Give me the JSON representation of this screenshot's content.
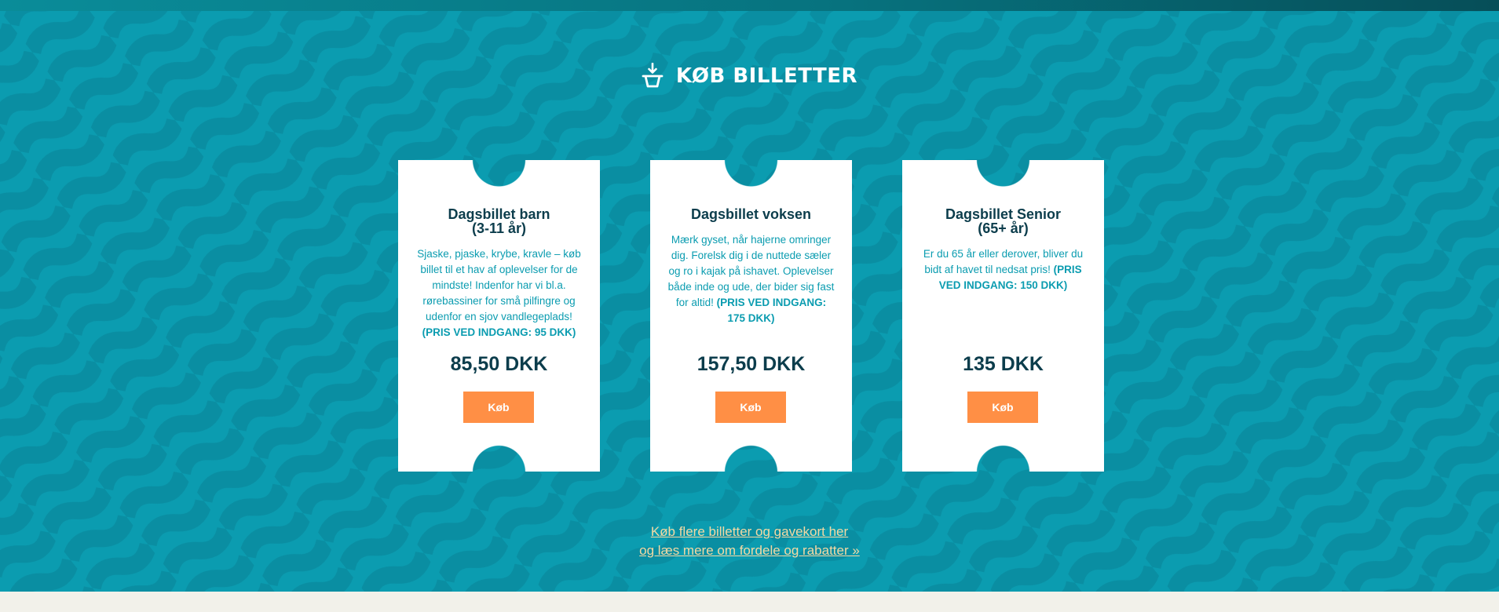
{
  "section": {
    "title": "KØB BILLETTER",
    "icon": "basket-download-icon"
  },
  "tickets": [
    {
      "title_line1": "Dagsbillet barn",
      "title_line2": "(3-11 år)",
      "description": "Sjaske, pjaske, krybe, kravle – køb billet til et hav af oplevelser for de mindste! Indenfor har vi bl.a. rørebassiner for små pilfingre og udenfor en sjov vandlegeplads!",
      "price_note": "(PRIS VED INDGANG: 95 DKK)",
      "price": "85,50 DKK",
      "button_label": "Køb"
    },
    {
      "title_line1": "Dagsbillet voksen",
      "title_line2": "",
      "description": "Mærk gyset, når hajerne omringer dig. Forelsk dig i de nuttede sæler og ro i kajak på ishavet. Oplevelser både inde og ude, der bider sig fast for altid!",
      "price_note": "(PRIS VED INDGANG: 175 DKK)",
      "price": "157,50 DKK",
      "button_label": "Køb"
    },
    {
      "title_line1": "Dagsbillet Senior",
      "title_line2": "(65+ år)",
      "description": "Er du 65 år eller derover, bliver du bidt af havet til nedsat pris!",
      "price_note": "(PRIS VED INDGANG: 150 DKK)",
      "price": "135 DKK",
      "button_label": "Køb"
    }
  ],
  "more_link": {
    "line1": "Køb flere billetter og gavekort her",
    "line2": "og læs mere om fordele og rabatter »"
  },
  "colors": {
    "background": "#0b9cb0",
    "wave": "#0a8fa3",
    "button": "#ff8f45",
    "title_text": "#0c3d4c",
    "link": "#f4d9a3"
  }
}
